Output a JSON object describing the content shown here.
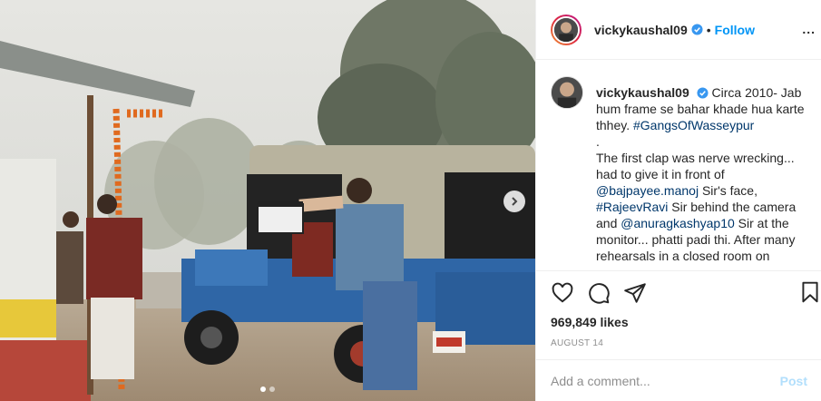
{
  "post": {
    "username": "vickykaushal09",
    "follow_label": "Follow",
    "separator": "•",
    "more_label": "...",
    "caption": {
      "username": "vickykaushal09",
      "text_1": " Circa 2010- Jab hum frame se bahar khade hua karte thhey. ",
      "hashtag_1": "#GangsOfWasseypur",
      "text_2": ".",
      "text_3": "The first clap was nerve wrecking... had to give it in front of ",
      "mention_1": "@bajpayee.manoj",
      "text_4": " Sir's face, ",
      "hashtag_2": "#RajeevRavi",
      "text_5": " Sir behind the camera and ",
      "mention_2": "@anuragkashyap10",
      "text_6": " Sir at the monitor... phatti padi thi. After many rehearsals in a closed room on"
    },
    "likes": "969,849 likes",
    "date": "AUGUST 14",
    "comment_placeholder": "Add a comment...",
    "post_label": "Post"
  },
  "carousel": {
    "slide_count": 2,
    "active_slide": 1
  },
  "colors": {
    "link": "#0095f6",
    "hashtag": "#00376b",
    "muted": "#8e8e8e",
    "post_disabled": "#b2dffc"
  },
  "icons": [
    "verified-badge-icon",
    "heart-icon",
    "comment-icon",
    "share-icon",
    "bookmark-icon",
    "next-arrow-icon",
    "more-options-icon"
  ]
}
